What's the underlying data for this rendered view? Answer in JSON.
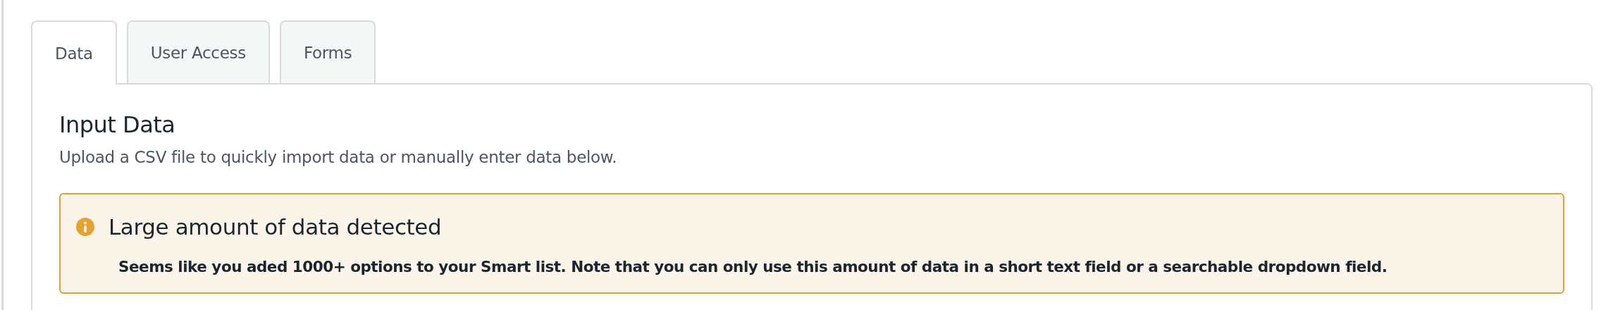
{
  "tabs": [
    {
      "label": "Data",
      "selected": true
    },
    {
      "label": "User Access",
      "selected": false
    },
    {
      "label": "Forms",
      "selected": false
    }
  ],
  "section": {
    "title": "Input Data",
    "subtitle": "Upload a CSV file to quickly import data or manually enter data below."
  },
  "alert": {
    "title": "Large amount of data detected",
    "message": "Seems like you aded 1000+ options to your Smart list. Note that you can only use this amount of data in a short text field or a searchable dropdown field."
  }
}
